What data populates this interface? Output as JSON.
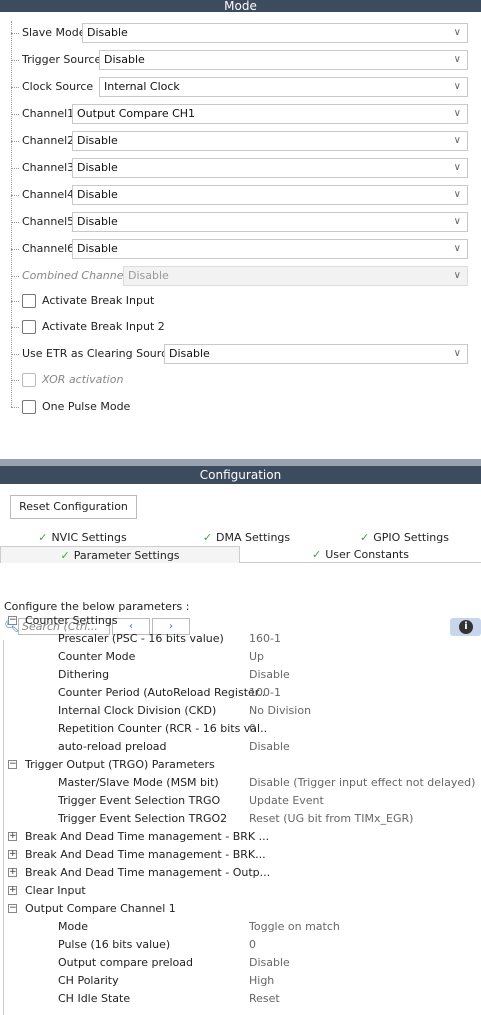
{
  "mode": {
    "header": "Mode",
    "fields": [
      {
        "label": "Slave Mode",
        "value": "Disable"
      },
      {
        "label": "Trigger Source",
        "value": "Disable"
      },
      {
        "label": "Clock Source",
        "value": "Internal Clock"
      },
      {
        "label": "Channel1",
        "value": "Output Compare CH1"
      },
      {
        "label": "Channel2",
        "value": "Disable"
      },
      {
        "label": "Channel3",
        "value": "Disable"
      },
      {
        "label": "Channel4",
        "value": "Disable"
      },
      {
        "label": "Channel5",
        "value": "Disable"
      },
      {
        "label": "Channel6",
        "value": "Disable"
      },
      {
        "label": "Combined Channels",
        "value": "Disable"
      }
    ],
    "checks": [
      {
        "label": "Activate Break Input"
      },
      {
        "label": "Activate Break Input 2"
      }
    ],
    "etr": {
      "label": "Use ETR as Clearing Source",
      "value": "Disable"
    },
    "xor": {
      "label": "XOR activation"
    },
    "one_pulse": {
      "label": "One Pulse Mode"
    }
  },
  "configuration": {
    "header": "Configuration",
    "reset_button": "Reset Configuration",
    "tabs_row1": [
      "NVIC Settings",
      "DMA Settings",
      "GPIO Settings"
    ],
    "tabs_row2": [
      "Parameter Settings",
      "User Constants"
    ],
    "description": "Configure the below parameters :",
    "search_placeholder": "Search (Ctrl...",
    "groups": {
      "counter": {
        "title": "Counter Settings",
        "params": [
          {
            "name": "Prescaler (PSC - 16 bits value)",
            "value": "160-1"
          },
          {
            "name": "Counter Mode",
            "value": "Up"
          },
          {
            "name": "Dithering",
            "value": "Disable"
          },
          {
            "name": "Counter Period (AutoReload Register..",
            "value": "100-1"
          },
          {
            "name": "Internal Clock Division (CKD)",
            "value": "No Division"
          },
          {
            "name": "Repetition Counter (RCR - 16 bits val..",
            "value": "0"
          },
          {
            "name": "auto-reload preload",
            "value": "Disable"
          }
        ]
      },
      "trgo": {
        "title": "Trigger Output (TRGO) Parameters",
        "params": [
          {
            "name": "Master/Slave Mode (MSM bit)",
            "value": "Disable (Trigger input effect not delayed)"
          },
          {
            "name": "Trigger Event Selection TRGO",
            "value": "Update Event"
          },
          {
            "name": "Trigger Event Selection TRGO2",
            "value": "Reset (UG bit from TIMx_EGR)"
          }
        ]
      },
      "collapsed": [
        "Break And Dead Time management - BRK ...",
        "Break And Dead Time management - BRK...",
        "Break And Dead Time management - Outp...",
        "Clear Input"
      ],
      "oc1": {
        "title": "Output Compare Channel 1",
        "params": [
          {
            "name": "Mode",
            "value": "Toggle on match"
          },
          {
            "name": "Pulse (16 bits value)",
            "value": "0"
          },
          {
            "name": "Output compare preload",
            "value": "Disable"
          },
          {
            "name": "CH Polarity",
            "value": "High"
          },
          {
            "name": "CH Idle State",
            "value": "Reset"
          }
        ]
      }
    }
  }
}
